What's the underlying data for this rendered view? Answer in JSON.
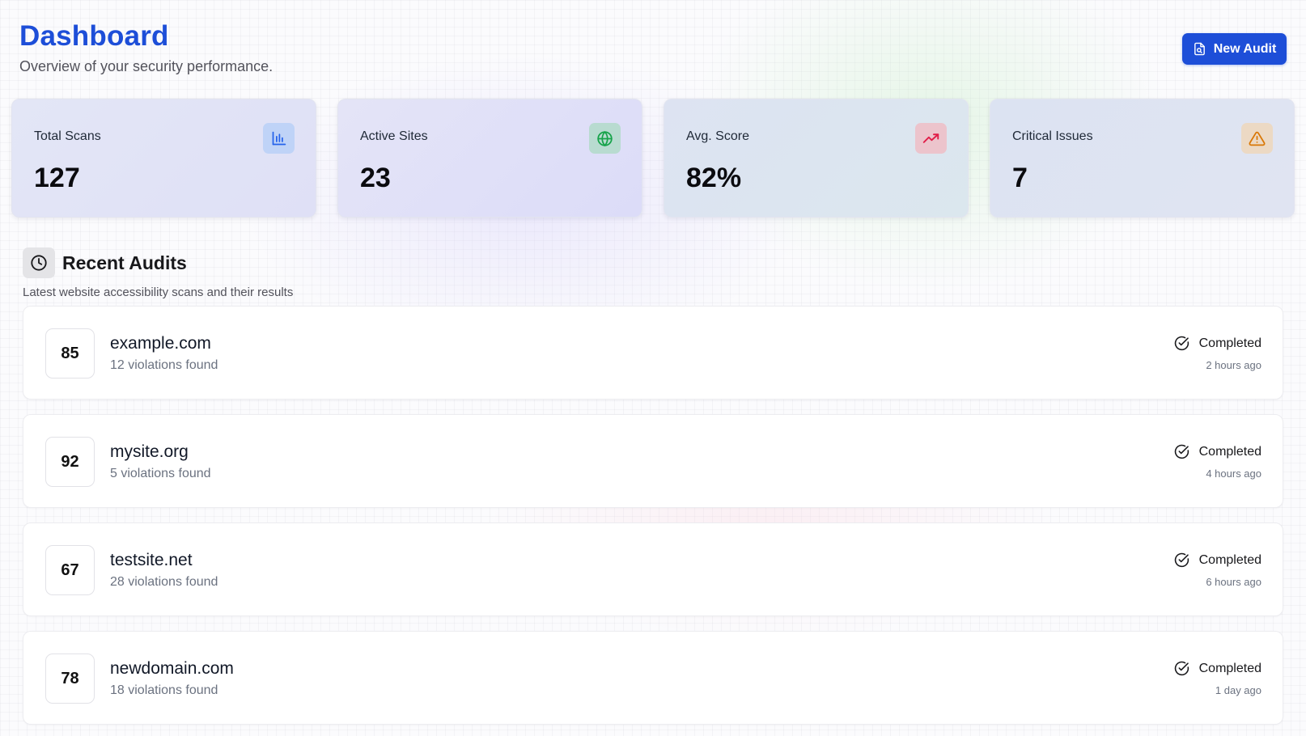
{
  "header": {
    "title": "Dashboard",
    "subtitle": "Overview of your security performance.",
    "new_audit_label": "New Audit",
    "new_audit_icon": "file-search-icon"
  },
  "stats": [
    {
      "label": "Total Scans",
      "value": "127",
      "icon": "bar-chart-icon",
      "color": "#2563eb"
    },
    {
      "label": "Active Sites",
      "value": "23",
      "icon": "globe-icon",
      "color": "#16a34a"
    },
    {
      "label": "Avg. Score",
      "value": "82%",
      "icon": "trending-up-icon",
      "color": "#e11d48"
    },
    {
      "label": "Critical Issues",
      "value": "7",
      "icon": "warning-triangle-icon",
      "color": "#d97706"
    }
  ],
  "recent": {
    "title": "Recent Audits",
    "description": "Latest website accessibility scans and their results",
    "icon": "clock-icon",
    "items": [
      {
        "score": "85",
        "domain": "example.com",
        "violations": "12 violations found",
        "status": "Completed",
        "time": "2 hours ago"
      },
      {
        "score": "92",
        "domain": "mysite.org",
        "violations": "5 violations found",
        "status": "Completed",
        "time": "4 hours ago"
      },
      {
        "score": "67",
        "domain": "testsite.net",
        "violations": "28 violations found",
        "status": "Completed",
        "time": "6 hours ago"
      },
      {
        "score": "78",
        "domain": "newdomain.com",
        "violations": "18 violations found",
        "status": "Completed",
        "time": "1 day ago"
      }
    ]
  },
  "colors": {
    "accent": "#1d4ed8"
  }
}
